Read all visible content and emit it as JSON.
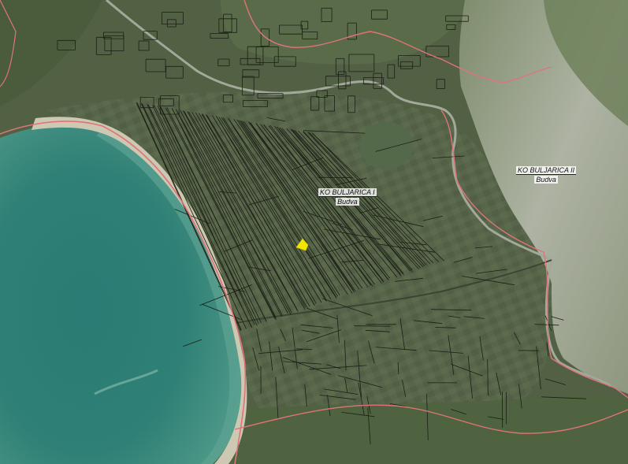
{
  "map": {
    "type": "cadastral-satellite",
    "colors": {
      "sea_deep": "#2f7a72",
      "sea_shallow": "#4e9a8c",
      "beach": "#c9c4ad",
      "fields": "#566446",
      "hills": "#5f7050",
      "rock": "#b8bcae",
      "parcel_lines": "#1b1f17",
      "boundary": "#e0737a",
      "road": "#9aa095",
      "highlight": "#f2e600"
    },
    "labels": [
      {
        "id": "buljarica-1",
        "name": "KO BULJARICA I",
        "municipality": "Budva"
      },
      {
        "id": "buljarica-2",
        "name": "KO BULJARICA II",
        "municipality": "Budva"
      }
    ],
    "highlighted_parcel": {
      "color": "#f2e600"
    }
  }
}
